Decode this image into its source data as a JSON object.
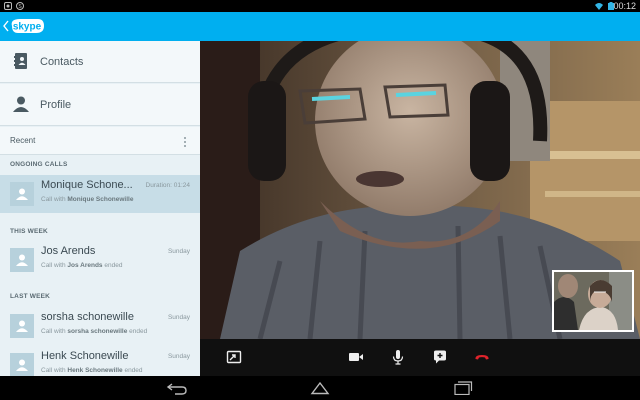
{
  "status_bar": {
    "time": "00:12"
  },
  "app_bar": {
    "logo_text": "skype"
  },
  "sidebar": {
    "nav": [
      {
        "label": "Contacts",
        "icon": "contacts-book-icon"
      },
      {
        "label": "Profile",
        "icon": "person-icon"
      }
    ],
    "recent_label": "Recent",
    "sections": {
      "ongoing": "ONGOING CALLS",
      "this_week": "THIS WEEK",
      "last_week": "LAST WEEK"
    },
    "calls": [
      {
        "name": "Monique Schone...",
        "meta": "Duration: 01:24",
        "sub_prefix": "Call with ",
        "sub_name": "Monique Schonewille",
        "sub_suffix": "",
        "active": true
      },
      {
        "name": "Jos Arends",
        "meta": "Sunday",
        "sub_prefix": "Call with ",
        "sub_name": "Jos Arends",
        "sub_suffix": " ended",
        "active": false
      },
      {
        "name": "sorsha schonewille",
        "meta": "Sunday",
        "sub_prefix": "Call with ",
        "sub_name": "sorsha schonewille",
        "sub_suffix": " ended",
        "active": false
      },
      {
        "name": "Henk Schonewille",
        "meta": "Sunday",
        "sub_prefix": "Call with ",
        "sub_name": "Henk Schonewille",
        "sub_suffix": " ended",
        "active": false
      }
    ]
  },
  "call_controls": {
    "icons": [
      "fullscreen-icon",
      "video-camera-icon",
      "microphone-icon",
      "add-chat-icon",
      "end-call-icon"
    ],
    "end_call_color": "#e0232b"
  },
  "colors": {
    "accent": "#00aff0",
    "sidebar_bg": "#e8f1f5",
    "active_row": "#c7dde7"
  }
}
